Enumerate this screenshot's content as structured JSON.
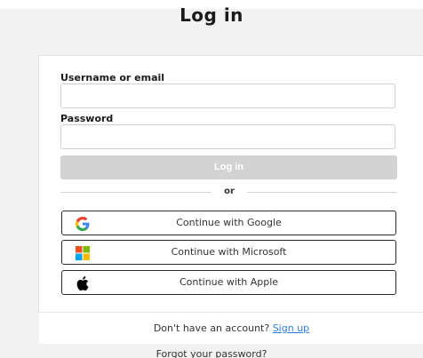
{
  "title": "Log in",
  "form": {
    "username_label": "Username or email",
    "username_value": "",
    "password_label": "Password",
    "password_value": "",
    "login_button": "Log in"
  },
  "divider_text": "or",
  "sso": {
    "google": "Continue with Google",
    "microsoft": "Continue with Microsoft",
    "apple": "Continue with Apple"
  },
  "footer": {
    "prompt": "Don't have an account?",
    "signup_link": "Sign up"
  },
  "forgot_link": "Forgot your password?",
  "colors": {
    "login_button_disabled": "#d3d3d3",
    "link": "#2a7de1",
    "google_blue": "#4285F4",
    "google_red": "#EA4335",
    "google_yellow": "#FBBC05",
    "google_green": "#34A853",
    "ms_red": "#F25022",
    "ms_green": "#7FBA00",
    "ms_blue": "#00A4EF",
    "ms_yellow": "#FFB900"
  }
}
